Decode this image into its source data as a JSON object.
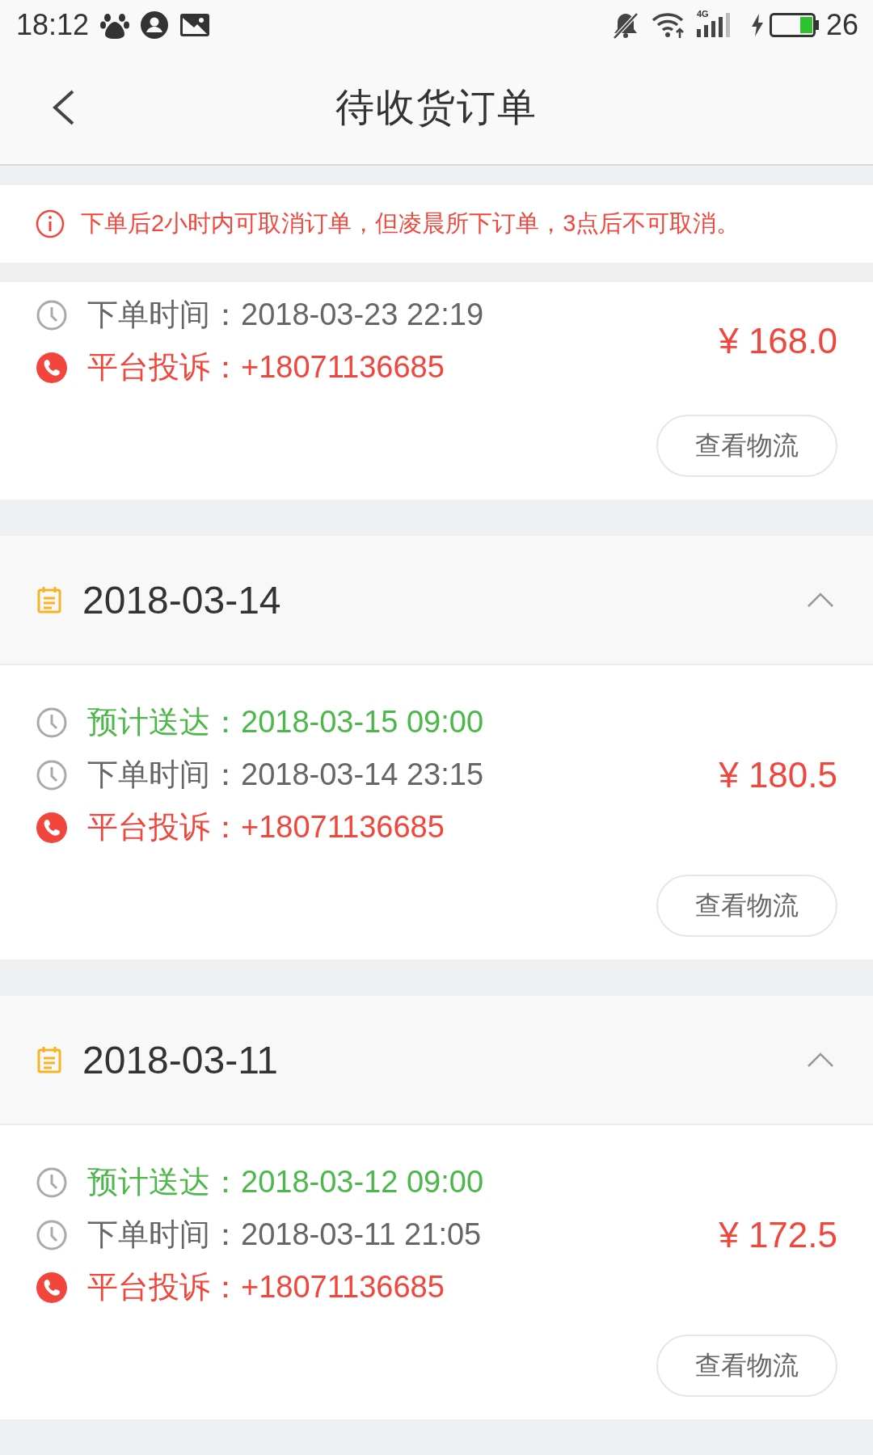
{
  "status_bar": {
    "time": "18:12",
    "network": "4G",
    "battery": {
      "text": "26",
      "level": 0.3
    }
  },
  "header": {
    "title": "待收货订单"
  },
  "notice": {
    "text": "下单后2小时内可取消订单，但凌晨所下订单，3点后不可取消。"
  },
  "groups": [
    {
      "orders": [
        {
          "lines": [
            {
              "kind": "placed",
              "text": "下单时间：2018-03-23 22:19"
            },
            {
              "kind": "complaint",
              "text": "平台投诉：+18071136685"
            }
          ],
          "price": "¥ 168.0",
          "button": "查看物流"
        }
      ]
    },
    {
      "date": "2018-03-14",
      "expanded": true,
      "orders": [
        {
          "lines": [
            {
              "kind": "eta",
              "text": "预计送达：2018-03-15 09:00"
            },
            {
              "kind": "placed",
              "text": "下单时间：2018-03-14 23:15"
            },
            {
              "kind": "complaint",
              "text": "平台投诉：+18071136685"
            }
          ],
          "price": "¥ 180.5",
          "button": "查看物流"
        }
      ]
    },
    {
      "date": "2018-03-11",
      "expanded": true,
      "orders": [
        {
          "lines": [
            {
              "kind": "eta",
              "text": "预计送达：2018-03-12 09:00"
            },
            {
              "kind": "placed",
              "text": "下单时间：2018-03-11 21:05"
            },
            {
              "kind": "complaint",
              "text": "平台投诉：+18071136685"
            }
          ],
          "price": "¥ 172.5",
          "button": "查看物流"
        }
      ]
    }
  ]
}
